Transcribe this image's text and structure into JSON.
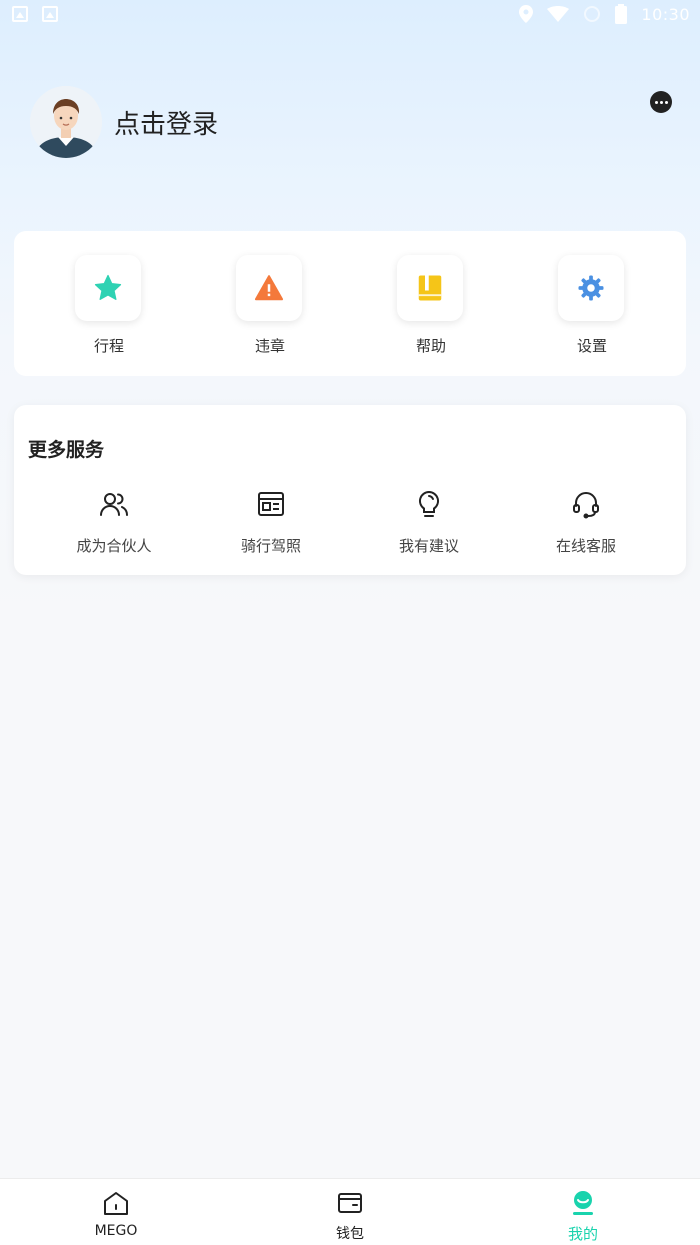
{
  "status_bar": {
    "time": "10:30"
  },
  "profile": {
    "login_text": "点击登录"
  },
  "quick_actions": [
    {
      "label": "行程",
      "icon": "star-icon",
      "color": "#2fd2b3"
    },
    {
      "label": "违章",
      "icon": "warning-icon",
      "color": "#f4793b"
    },
    {
      "label": "帮助",
      "icon": "book-icon",
      "color": "#f5c518"
    },
    {
      "label": "设置",
      "icon": "gear-icon",
      "color": "#4a90e2"
    }
  ],
  "more_services": {
    "title": "更多服务",
    "items": [
      {
        "label": "成为合伙人",
        "icon": "partners-icon"
      },
      {
        "label": "骑行驾照",
        "icon": "license-icon"
      },
      {
        "label": "我有建议",
        "icon": "lightbulb-icon"
      },
      {
        "label": "在线客服",
        "icon": "headset-icon"
      }
    ]
  },
  "tabs": [
    {
      "label": "MEGO",
      "icon": "home-icon"
    },
    {
      "label": "钱包",
      "icon": "wallet-icon"
    },
    {
      "label": "我的",
      "icon": "profile-icon",
      "active": true
    }
  ],
  "colors": {
    "accent": "#19d3ad"
  }
}
